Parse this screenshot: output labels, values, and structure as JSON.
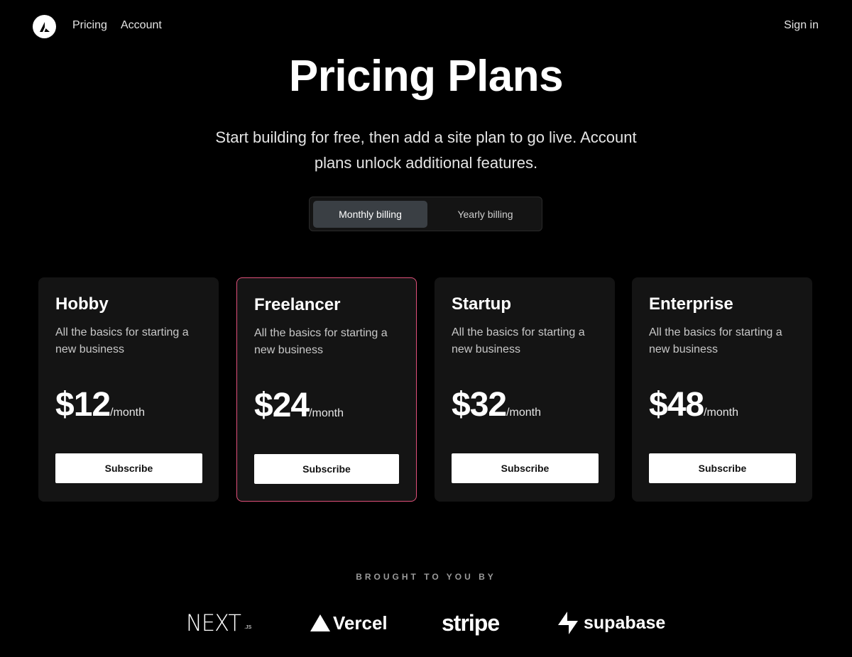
{
  "nav": {
    "logo_icon": "triangle-logo-icon",
    "links": [
      "Pricing",
      "Account"
    ],
    "sign_in": "Sign in"
  },
  "hero": {
    "title": "Pricing Plans",
    "subtitle": "Start building for free, then add a site plan to go live. Account plans unlock additional features."
  },
  "billing_toggle": {
    "options": [
      "Monthly billing",
      "Yearly billing"
    ],
    "selected": "Monthly billing"
  },
  "plans": [
    {
      "name": "Hobby",
      "description": "All the basics for starting a new business",
      "price": "$12",
      "unit": "/month",
      "button": "Subscribe",
      "featured": false
    },
    {
      "name": "Freelancer",
      "description": "All the basics for starting a new business",
      "price": "$24",
      "unit": "/month",
      "button": "Subscribe",
      "featured": true
    },
    {
      "name": "Startup",
      "description": "All the basics for starting a new business",
      "price": "$32",
      "unit": "/month",
      "button": "Subscribe",
      "featured": false
    },
    {
      "name": "Enterprise",
      "description": "All the basics for starting a new business",
      "price": "$48",
      "unit": "/month",
      "button": "Subscribe",
      "featured": false
    }
  ],
  "colors": {
    "background": "#000000",
    "card": "#141414",
    "featured_border": "#e0507a",
    "toggle_active": "#3a3f44"
  },
  "sponsors": {
    "heading": "BROUGHT TO YOU BY",
    "items": [
      {
        "name": "NEXT",
        "suffix": ".JS",
        "icon": "nextjs-logo"
      },
      {
        "name": "Vercel",
        "icon": "vercel-triangle-icon"
      },
      {
        "name": "stripe",
        "icon": "stripe-logo"
      },
      {
        "name": "supabase",
        "icon": "supabase-bolt-icon"
      }
    ]
  }
}
